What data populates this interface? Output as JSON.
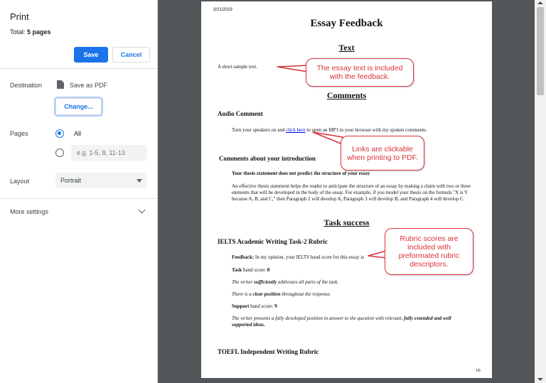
{
  "panel": {
    "title": "Print",
    "total_label": "Total:",
    "total_value": "5 pages",
    "save_label": "Save",
    "cancel_label": "Cancel",
    "destination_label": "Destination",
    "destination_value": "Save as PDF",
    "change_label": "Change...",
    "pages_label": "Pages",
    "pages_all_label": "All",
    "pages_custom_placeholder": "e.g. 1-5, 8, 11-13",
    "layout_label": "Layout",
    "layout_value": "Portrait",
    "more_settings_label": "More settings"
  },
  "document": {
    "date": "3/21/2019",
    "title": "Essay Feedback",
    "text_heading": "Text",
    "text_body": "A short sample text.",
    "comments_heading": "Comments",
    "audio_heading": "Audio Comment",
    "audio_before": "Turn your speakers on and ",
    "audio_link": "click here",
    "audio_after": " to open an MP3 in your browser with my spoken comments.",
    "intro_heading": "Comments about your introduction",
    "intro_sub": "Your thesis statement does not predict the structure of your essay",
    "intro_body": "An effective thesis statement helps the reader to anticipate the structure of an essay by making a claim with two or three elements that will be developed in the body of the essay. For example, if you model your thesis on the formula \"X is Y because A, B, and C,\" then Paragraph 2 will develop A, Paragraph 3 will develop B, and Paragraph 4 will develop C.",
    "task_heading": "Task success",
    "ielts_heading": "IELTS Academic Writing Task-2 Rubric",
    "feedback_label": "Feedback:",
    "feedback_text": " In my opinion, your IELTS band score for this essay is",
    "task_band_label": "Task",
    "task_band_rest": " band score: ",
    "task_band_value": "8",
    "task_desc_1a": "The writer ",
    "task_desc_1b": "sufficiently",
    "task_desc_1c": " addresses all parts of the task.",
    "task_desc_2a": "There is a ",
    "task_desc_2b": "clear position",
    "task_desc_2c": " throughout the response.",
    "support_band_label": "Support",
    "support_band_rest": " band score: ",
    "support_band_value": "9",
    "support_desc_a": "The writer presents a fully developed position in answer to the question with relevant, ",
    "support_desc_b": "fully extended and well supported ideas.",
    "toefl_heading": "TOEFL Independent Writing Rubric",
    "page_number": "1/5"
  },
  "callouts": {
    "essay": "The essay text is included with the feedback.",
    "links": "Links are clickable when printing to PDF.",
    "rubric": "Rubric scores are included with preformated rubric descriptors."
  },
  "colors": {
    "accent": "#1a73e8",
    "preview_bg": "#525659",
    "callout": "#d9323a"
  }
}
